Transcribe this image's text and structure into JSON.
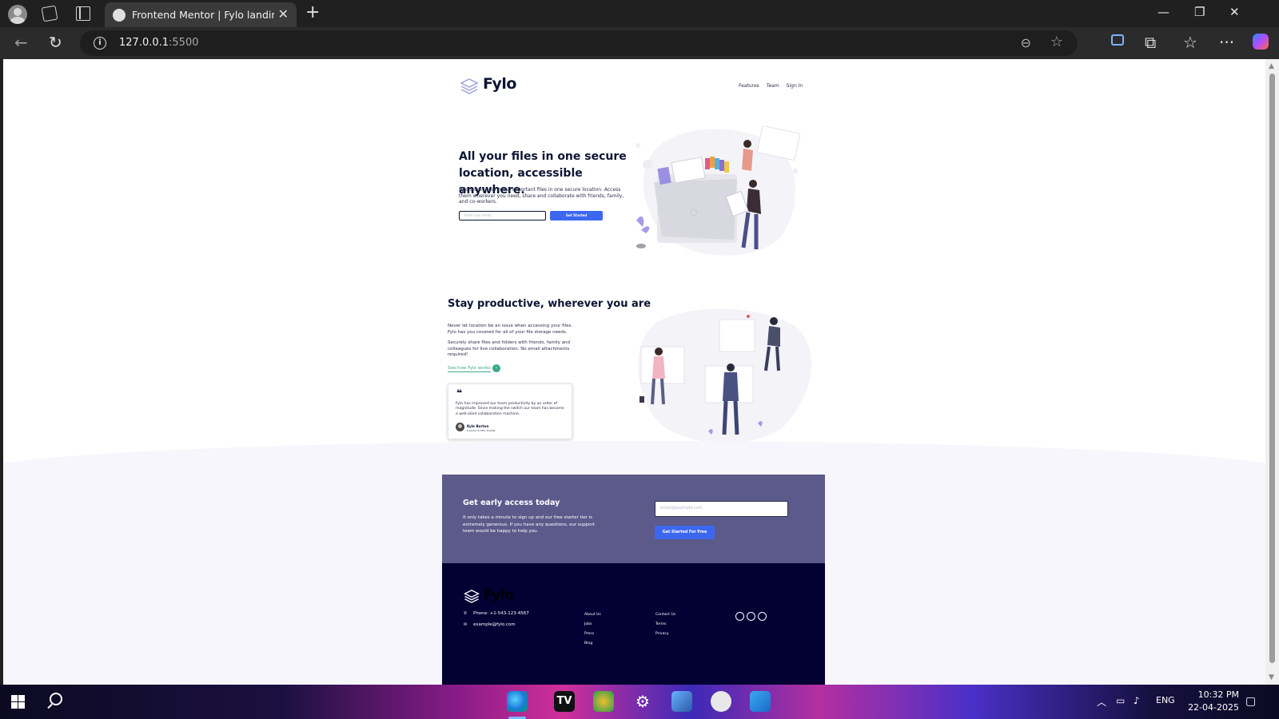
{
  "browser": {
    "tab_title": "Frontend Mentor | Fylo landing page",
    "tab_close": "✕",
    "new_tab": "+",
    "url_host": "127.0.0.1",
    "url_port": ":5500",
    "window_controls": [
      "—",
      "❐",
      "✕"
    ]
  },
  "page": {
    "header": {
      "brand": "Fylo",
      "nav": [
        "Features",
        "Team",
        "Sign In"
      ]
    },
    "hero": {
      "title": "All your files in one secure location, accessible anywhere.",
      "text": "Fylo stores your most important files in one secure location. Access them wherever you need, share and collaborate with friends, family, and co-workers.",
      "email_placeholder": "Enter your email...",
      "button": "Get Started"
    },
    "productive": {
      "title": "Stay productive, wherever you are",
      "p1": "Never let location be an issue when accessing your files. Fylo has you covered for all of your file storage needs.",
      "p2": "Securely share files and folders with friends, family and colleagues for live collaboration. No email attachments required!",
      "link": "See how Fylo works",
      "testimonial": {
        "quote_mark": "❝",
        "quote": "Fylo has improved our team productivity by an order of magnitude. Since making the switch our team has become a well-oiled collaboration machine.",
        "name": "Kyle Burton",
        "role": "Founder & CEO, Huddle"
      }
    },
    "early_access": {
      "title": "Get early access today",
      "text": "It only takes a minute to sign up and our free starter tier is extremely generous. If you have any questions, our support team would be happy to help you.",
      "email_placeholder": "email@example.com",
      "button": "Get Started For Free"
    },
    "footer": {
      "brand": "Fylo",
      "phone": "Phone: +1-543-123-4567",
      "email": "example@fylo.com",
      "links_col1": [
        "About Us",
        "Jobs",
        "Press",
        "Blog"
      ],
      "links_col2": [
        "Contact Us",
        "Terms",
        "Privacy"
      ]
    }
  },
  "taskbar": {
    "lang": "ENG",
    "time": "10:32 PM",
    "date": "22-04-2025"
  },
  "colors": {
    "accent_blue": "#3c68f0",
    "cta_bg": "#5c5a8b",
    "footer_bg": "#030034",
    "link_teal": "#3ca88c"
  }
}
